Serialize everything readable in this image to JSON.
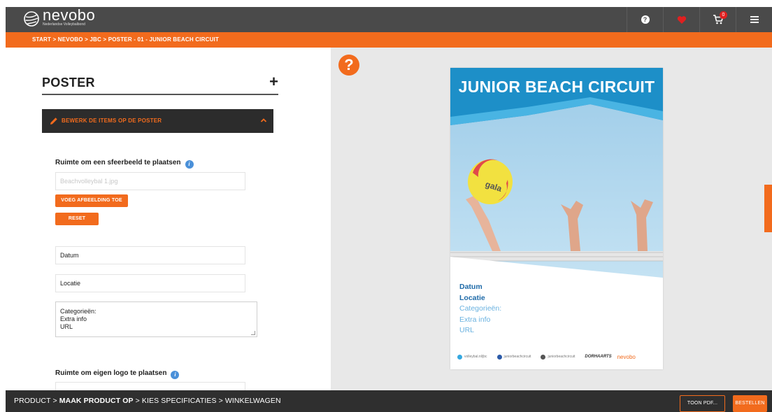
{
  "header": {
    "brand": "nevobo",
    "brand_subtitle": "Nederlandse Volleybalbond",
    "cart_count": "0",
    "icons": [
      "help-icon",
      "heart-icon",
      "cart-icon",
      "menu-icon"
    ],
    "colors": {
      "bar": "#4a4a4a",
      "accent": "#f26b1d",
      "heart": "#e02020"
    }
  },
  "breadcrumb": "START  >  NEVOBO  >  JBC  >  POSTER - 01 - JUNIOR BEACH CIRCUIT",
  "panel": {
    "title": "POSTER",
    "accordion_label": "BEWERK DE ITEMS OP DE POSTER",
    "image_section": {
      "label": "Ruimte om een sfeerbeeld te plaatsen",
      "file_placeholder": "Beachvolleybal 1.jpg",
      "add_button": "VOEG AFBEELDING TOE",
      "reset_button": "RESET"
    },
    "fields": {
      "datum": "Datum",
      "locatie": "Locatie",
      "textarea_lines": [
        "Categorieën:",
        "Extra info",
        "URL"
      ]
    },
    "logo_section": {
      "label": "Ruimte om eigen logo te plaatsen"
    }
  },
  "preview": {
    "poster_title": "JUNIOR BEACH CIRCUIT",
    "info_lines": [
      "Datum",
      "Locatie",
      "Categorieën:",
      "Extra info",
      "URL"
    ],
    "ball_text": "gala",
    "footer": {
      "handle_1": "volleybal.nl/jbc",
      "handle_2": "juniorbeachcircuit",
      "handle_3": "juniorbeachcircuit",
      "sponsor": "DORHAARTS",
      "nevobo": "nevobo"
    }
  },
  "bottom": {
    "steps": [
      {
        "label": "PRODUCT",
        "current": false
      },
      {
        "label": "MAAK PRODUCT OP",
        "current": true
      },
      {
        "label": "KIES SPECIFICATIES",
        "current": false
      },
      {
        "label": "WINKELWAGEN",
        "current": false
      }
    ],
    "separator": " > ",
    "preview_button": "TOON PDF...",
    "order_button": "BESTELLEN"
  }
}
